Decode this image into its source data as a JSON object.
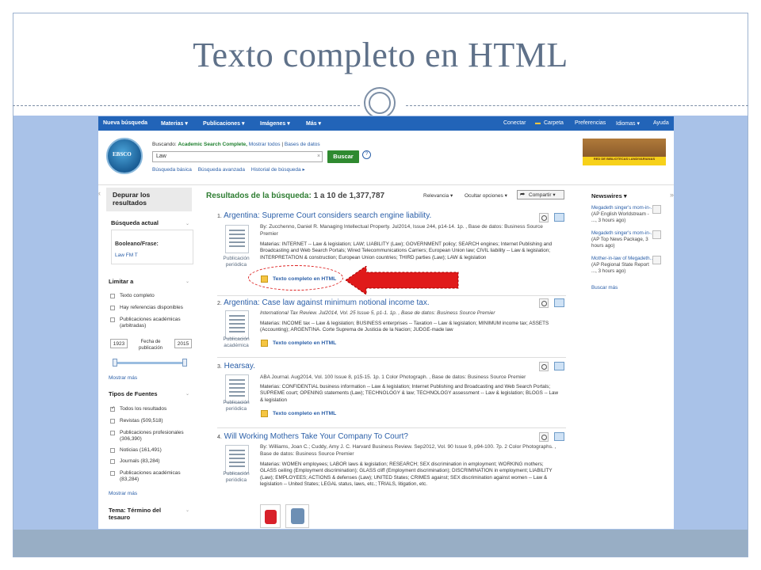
{
  "slide": {
    "title": "Texto completo en HTML"
  },
  "nav": {
    "left": [
      "Nueva búsqueda",
      "Materias ▾",
      "Publicaciones ▾",
      "Imágenes ▾",
      "Más ▾"
    ],
    "right": [
      "Conectar",
      "Carpeta",
      "Preferencias",
      "Idiomas ▾",
      "Ayuda"
    ]
  },
  "search": {
    "logo_text": "EBSCO",
    "searching_label": "Buscando:",
    "database": "Academic Search Complete,",
    "show_all": "Mostrar todos",
    "separator": "|",
    "choose_db": "Bases de datos",
    "query": "Law",
    "clear": "×",
    "button": "Buscar",
    "help": "?",
    "basic": "Búsqueda básica",
    "advanced": "Búsqueda avanzada",
    "history": "Historial de búsqueda ▸"
  },
  "library_logo": {
    "band_text": "RED DE BIBLIOTECAS LANDIVARIANAS"
  },
  "refine": {
    "title": "Depurar los resultados",
    "current": "Búsqueda actual",
    "boolean_label": "Booleano/Frase:",
    "boolean_value": "Law FM T",
    "limit": "Limitar a",
    "limits": [
      "Texto completo",
      "Hay referencias disponibles",
      "Publicaciones académicas (arbitradas)"
    ],
    "date_from": "1923",
    "date_label": "Fecha de publicación",
    "date_to": "2015",
    "show_more_1": "Mostrar más",
    "source_types": "Tipos de Fuentes",
    "sources": [
      {
        "label": "Todos los resultados",
        "checked": true
      },
      {
        "label": "Revistas (509,518)",
        "checked": false
      },
      {
        "label": "Publicaciones profesionales (306,390)",
        "checked": false
      },
      {
        "label": "Noticias (161,491)",
        "checked": false
      },
      {
        "label": "Journals (83,284)",
        "checked": false
      },
      {
        "label": "Publicaciones académicas (83,284)",
        "checked": false
      }
    ],
    "show_more_2": "Mostrar más",
    "subject": "Tema: Término del tesauro"
  },
  "results_header": {
    "label": "Resultados de la búsqueda:",
    "range": "1 a 10 de 1,377,787",
    "relevance": "Relevancia ▾",
    "page_options": "Ocultar opciones ▾",
    "share": "Compartir ▾"
  },
  "results": [
    {
      "num": "1.",
      "title": "Argentina: Supreme Court considers search engine liability.",
      "meta": "By: Zucchenno, Daniel R. Managing Intellectual Property. Jul2014, Issue 244, p14-14. 1p. , Base de datos: Business Source Premier",
      "subjects": "Materias: INTERNET -- Law & legislation; LAW; LIABILITY (Law); GOVERNMENT policy; SEARCH engines; Internet Publishing and Broadcasting and Web Search Portals; Wired Telecommunications Carriers; European Union law; CIVIL liability -- Law & legislation; INTERPRETATION & construction; European Union countries; THIRD parties (Law); LAW & legislation",
      "type": "Publicación periódica",
      "full_text": "Texto completo en HTML"
    },
    {
      "num": "2.",
      "title": "Argentina: Case law against minimum notional income tax.",
      "meta": "International Tax Review. Jul2014, Vol. 25 Issue 5, p1-1. 1p. , Base de datos: Business Source Premier",
      "subjects": "Materias: INCOME tax -- Law & legislation; BUSINESS enterprises -- Taxation -- Law & legislation; MINIMUM income tax; ASSETS (Accounting); ARGENTINA. Corte Suprema de Justicia de la Nacion; JUDGE-made law",
      "type": "Publicación académica",
      "full_text": "Texto completo en HTML"
    },
    {
      "num": "3.",
      "title": "Hearsay.",
      "meta": "ABA Journal. Aug2014, Vol. 100 Issue 8, p15-15. 1p. 1 Color Photograph. , Base de datos: Business Source Premier",
      "subjects": "Materias: CONFIDENTIAL business information -- Law & legislation; Internet Publishing and Broadcasting and Web Search Portals; SUPREME court; OPENING statements (Law); TECHNOLOGY & law; TECHNOLOGY assessment -- Law & legislation; BLOGS -- Law & legislation",
      "type": "Publicación periódica",
      "full_text": "Texto completo en HTML"
    },
    {
      "num": "4.",
      "title": "Will Working Mothers Take Your Company To Court?",
      "meta": "By: Williams, Joan C.; Cuddy, Amy J. C. Harvard Business Review. Sep2012, Vol. 90 Issue 9, p94-100. 7p. 2 Color Photographs. , Base de datos: Business Source Premier",
      "subjects": "Materias: WOMEN employees; LABOR laws & legislation; RESEARCH; SEX discrimination in employment; WORKING mothers; GLASS ceiling (Employment discrimination); GLASS cliff (Employment discrimination); DISCRIMINATION in employment; LIABILITY (Law); EMPLOYEES; ACTIONS & defenses (Law); UNITED States; CRIMES against; SEX discrimination against women -- Law & legislation -- United States; LEGAL status, laws, etc.; TRIALS, litigation, etc.",
      "type": "Publicación periódica"
    }
  ],
  "newswires": {
    "title": "Newswires ▾",
    "items": [
      {
        "link": "Megadeth singer's mom-in-..",
        "text": "(AP English Worldstream - ..., 3 hours ago)"
      },
      {
        "link": "Megadeth singer's mom-in-..",
        "text": "(AP Top News Package, 3 hours ago)"
      },
      {
        "link": "Mother-in-law of Megadeth..",
        "text": "(AP Regional State Report ..., 3 hours ago)"
      }
    ],
    "more": "Buscar más"
  },
  "colors": {
    "nav": "#2264b8",
    "accent_green": "#2f8a30",
    "link": "#2b5fa8",
    "annotation": "#e01a1a"
  }
}
